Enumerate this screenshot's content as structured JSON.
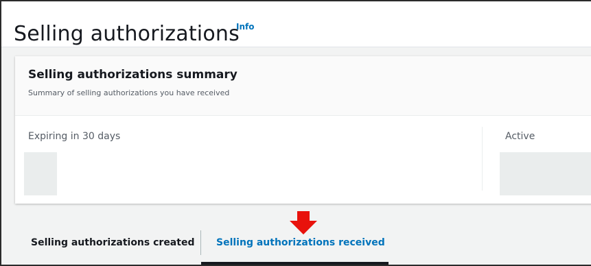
{
  "header": {
    "title": "Selling authorizations",
    "info_link": "Info"
  },
  "summary": {
    "title": "Selling authorizations summary",
    "subtitle": "Summary of selling authorizations you have received",
    "stats": [
      {
        "label": "Expiring in 30 days"
      },
      {
        "label": "Active"
      }
    ]
  },
  "tabs": [
    {
      "label": "Selling authorizations created",
      "selected": false
    },
    {
      "label": "Selling authorizations received",
      "selected": true
    }
  ],
  "colors": {
    "link": "#0073bb",
    "annotation_arrow": "#e8120c"
  },
  "icons": {
    "annotation": "red-down-arrow-icon"
  }
}
